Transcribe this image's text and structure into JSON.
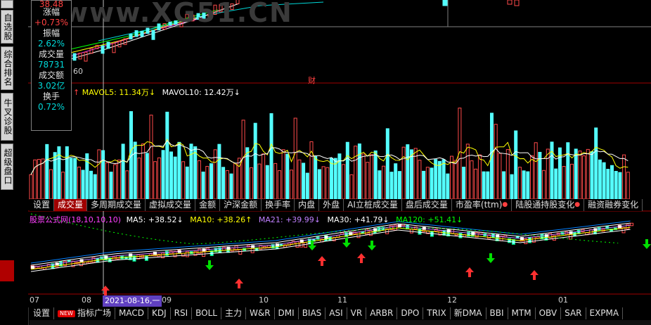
{
  "left_strip": {
    "buttons": [
      "自选股",
      "综合排名",
      "牛叉诊股",
      "超级盘口"
    ]
  },
  "info_box": {
    "top_value": "38.48",
    "change_label": "涨幅",
    "change_value": "+0.73%",
    "amplitude_label": "振幅",
    "amplitude_value": "2.62%",
    "volume_label": "成交量",
    "volume_value": "78731",
    "turnover_label": "成交额",
    "turnover_value": "3.02亿",
    "rate_label": "换手",
    "rate_value": "0.72%",
    "low_price": "60"
  },
  "watermark": "www.XG51.CN",
  "cai_label": "财",
  "volume_legend": {
    "mavol5": "MAVOL5: 11.34万↓",
    "mavol10": "MAVOL10: 12.42万↓"
  },
  "volume_tabs": [
    {
      "label": "设置",
      "active": false
    },
    {
      "label": "成交量",
      "active": true
    },
    {
      "label": "多周期成交量",
      "active": false
    },
    {
      "label": "虚拟成交量",
      "active": false
    },
    {
      "label": "金额",
      "active": false
    },
    {
      "label": "沪深金额",
      "active": false
    },
    {
      "label": "换手率",
      "active": false
    },
    {
      "label": "内盘",
      "active": false
    },
    {
      "label": "外盘",
      "active": false
    },
    {
      "label": "AI立桩成交量",
      "active": false
    },
    {
      "label": "盘后成交量",
      "active": false
    },
    {
      "label": "市盈率(ttm)",
      "active": false,
      "dot": true
    },
    {
      "label": "陆股通持股变化",
      "active": false,
      "dot": true
    },
    {
      "label": "融资融券变化",
      "active": false
    }
  ],
  "formula_legend": {
    "name": "股票公式网(18,10,10,10)",
    "ma5": "MA5: +38.52↓",
    "ma10": "MA10: +38.26↑",
    "ma21": "MA21: +39.99↓",
    "ma30": "MA30: +41.79↓",
    "ma120": "MA120: +51.41↓"
  },
  "date_axis": {
    "labels": [
      "07",
      "08",
      "09",
      "10",
      "11",
      "12",
      "01"
    ],
    "cursor_date": "2021-08-16,一"
  },
  "indicator_tabs": [
    {
      "label": "设置",
      "new": false
    },
    {
      "label": "指标广场",
      "new": true
    },
    {
      "label": "MACD",
      "new": false
    },
    {
      "label": "KDJ",
      "new": false
    },
    {
      "label": "RSI",
      "new": false
    },
    {
      "label": "BOLL",
      "new": false
    },
    {
      "label": "主力",
      "new": false
    },
    {
      "label": "W&R",
      "new": false
    },
    {
      "label": "DMI",
      "new": false
    },
    {
      "label": "BIAS",
      "new": false
    },
    {
      "label": "ASI",
      "new": false
    },
    {
      "label": "VR",
      "new": false
    },
    {
      "label": "ARBR",
      "new": false
    },
    {
      "label": "DPO",
      "new": false
    },
    {
      "label": "TRIX",
      "new": false
    },
    {
      "label": "新DMA",
      "new": false
    },
    {
      "label": "BBI",
      "new": false
    },
    {
      "label": "MTM",
      "new": false
    },
    {
      "label": "OBV",
      "new": false
    },
    {
      "label": "SAR",
      "new": false
    },
    {
      "label": "EXPMA",
      "new": false
    }
  ],
  "colors": {
    "up": "#ff4a4a",
    "down": "#54ffff",
    "ma5": "#ffffff",
    "ma10": "#ffff00",
    "ma21": "#ff40ff",
    "ma30": "#00ff00",
    "ma120": "#00ff00",
    "buy_arrow": "#ff3030",
    "sell_arrow": "#00e000"
  },
  "chart_data": {
    "type": "bar",
    "title": "",
    "volume_series_count": 150,
    "note_source": "volume bars (red up / cyan down) with MAVOL5, MAVOL10 overlays"
  }
}
